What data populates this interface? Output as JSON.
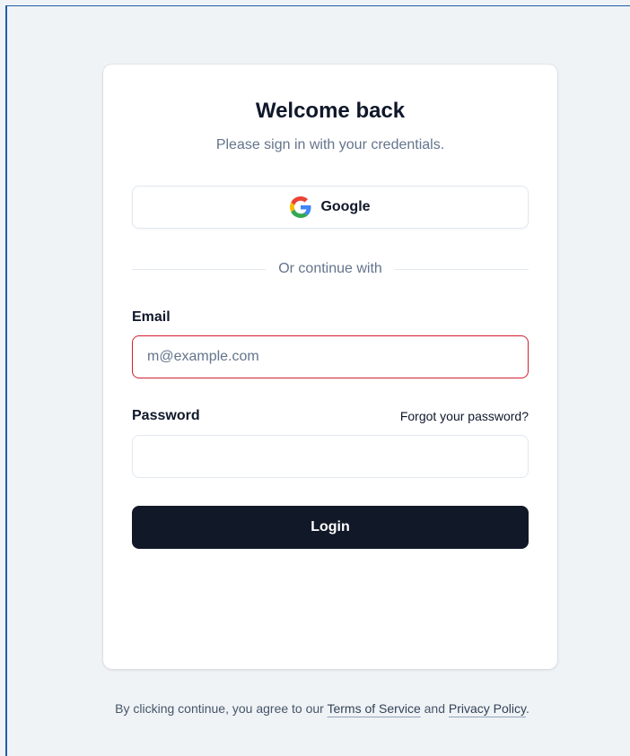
{
  "card": {
    "title": "Welcome back",
    "subtitle": "Please sign in with your credentials."
  },
  "google_button": {
    "label": "Google",
    "icon": "google-icon"
  },
  "divider": {
    "text": "Or continue with"
  },
  "email": {
    "label": "Email",
    "placeholder": "m@example.com",
    "value": "",
    "border_color": "#d11f2f"
  },
  "password": {
    "label": "Password",
    "forgot_link": "Forgot your password?",
    "value": ""
  },
  "login_button": {
    "label": "Login",
    "color": "#111827"
  },
  "footer": {
    "prefix": "By clicking continue, you agree to our",
    "terms": "Terms of Service",
    "and": "and",
    "privacy": "Privacy Policy",
    "suffix": "."
  }
}
